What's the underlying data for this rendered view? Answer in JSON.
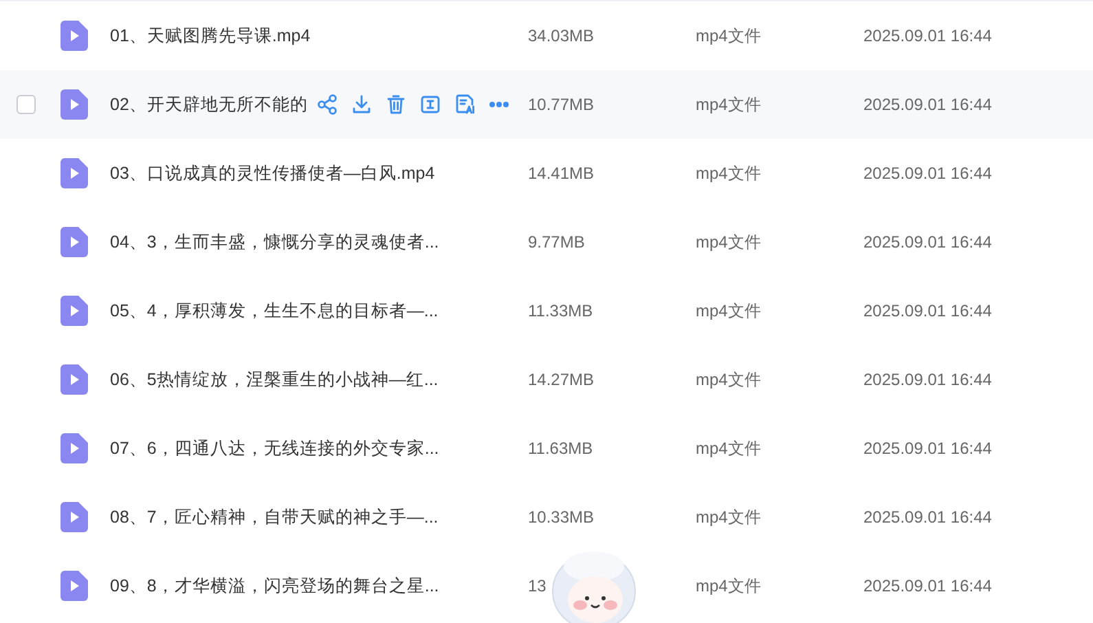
{
  "files": [
    {
      "name": "01、天赋图腾先导课.mp4",
      "size": "34.03MB",
      "type": "mp4文件",
      "modified": "2025.09.01 16:44",
      "hovered": false
    },
    {
      "name": "02、开天辟地无所不能的",
      "size": "10.77MB",
      "type": "mp4文件",
      "modified": "2025.09.01 16:44",
      "hovered": true
    },
    {
      "name": "03、口说成真的灵性传播使者—白风.mp4",
      "size": "14.41MB",
      "type": "mp4文件",
      "modified": "2025.09.01 16:44",
      "hovered": false
    },
    {
      "name": "04、3，生而丰盛，慷慨分享的灵魂使者...",
      "size": "9.77MB",
      "type": "mp4文件",
      "modified": "2025.09.01 16:44",
      "hovered": false
    },
    {
      "name": "05、4，厚积薄发，生生不息的目标者—...",
      "size": "11.33MB",
      "type": "mp4文件",
      "modified": "2025.09.01 16:44",
      "hovered": false
    },
    {
      "name": "06、5热情绽放，涅槃重生的小战神—红...",
      "size": "14.27MB",
      "type": "mp4文件",
      "modified": "2025.09.01 16:44",
      "hovered": false
    },
    {
      "name": "07、6，四通八达，无线连接的外交专家...",
      "size": "11.63MB",
      "type": "mp4文件",
      "modified": "2025.09.01 16:44",
      "hovered": false
    },
    {
      "name": "08、7，匠心精神，自带天赋的神之手—...",
      "size": "10.33MB",
      "type": "mp4文件",
      "modified": "2025.09.01 16:44",
      "hovered": false
    },
    {
      "name": "09、8，才华横溢，闪亮登场的舞台之星...",
      "size": "13",
      "type": "mp4文件",
      "modified": "2025.09.01 16:44",
      "hovered": false
    }
  ]
}
